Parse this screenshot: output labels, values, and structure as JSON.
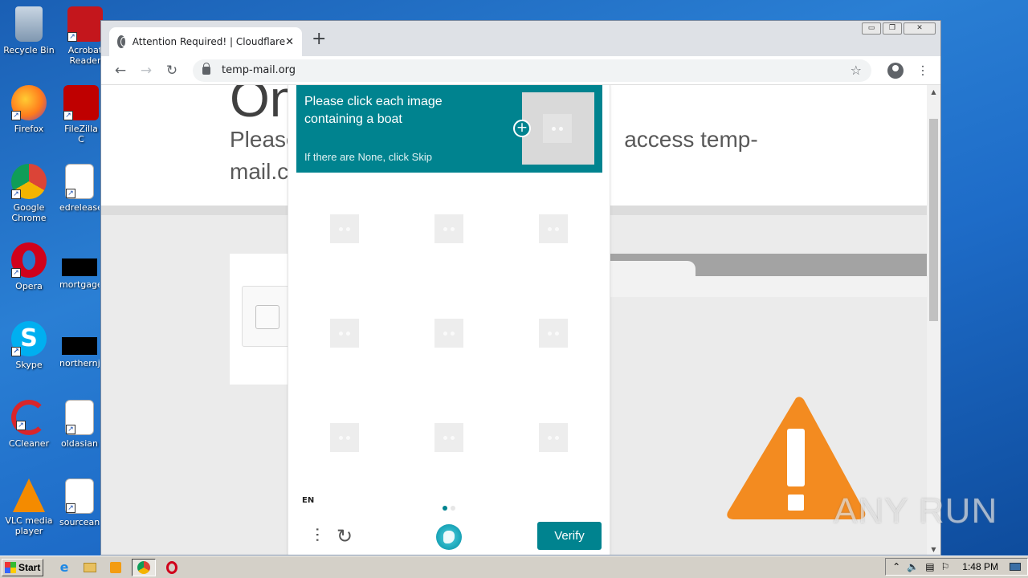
{
  "desktop": {
    "icons": [
      {
        "label": "Recycle Bin"
      },
      {
        "label": "Acrobat Reader"
      },
      {
        "label": "Firefox"
      },
      {
        "label": "FileZilla C"
      },
      {
        "label": "Google Chrome"
      },
      {
        "label": "edrelease"
      },
      {
        "label": "Opera"
      },
      {
        "label": "mortgage"
      },
      {
        "label": "Skype"
      },
      {
        "label": "northernj"
      },
      {
        "label": "CCleaner"
      },
      {
        "label": "oldasian"
      },
      {
        "label": "VLC media player"
      },
      {
        "label": "sourcean"
      }
    ]
  },
  "browser": {
    "tab_title": "Attention Required! | Cloudflare",
    "tab_close": "✕",
    "new_tab": "+",
    "url": "temp-mail.org",
    "window_controls": {
      "minimize": "▭",
      "restore": "❐",
      "close": "✕"
    }
  },
  "page": {
    "hero_title": "On",
    "hero_sub_left": "Please",
    "hero_sub_right": "access temp-",
    "hero_sub_line2": "mail.c"
  },
  "captcha": {
    "prompt": "Please click each image containing a boat",
    "skip_hint": "If there are None, click Skip",
    "language": "EN",
    "verify_label": "Verify",
    "grid_rows": 3,
    "grid_cols": 3,
    "page_index": 1,
    "page_count": 2,
    "accent_color": "#00838f"
  },
  "watermark": "ANY RUN",
  "taskbar": {
    "start_label": "Start",
    "clock": "1:48 PM"
  }
}
